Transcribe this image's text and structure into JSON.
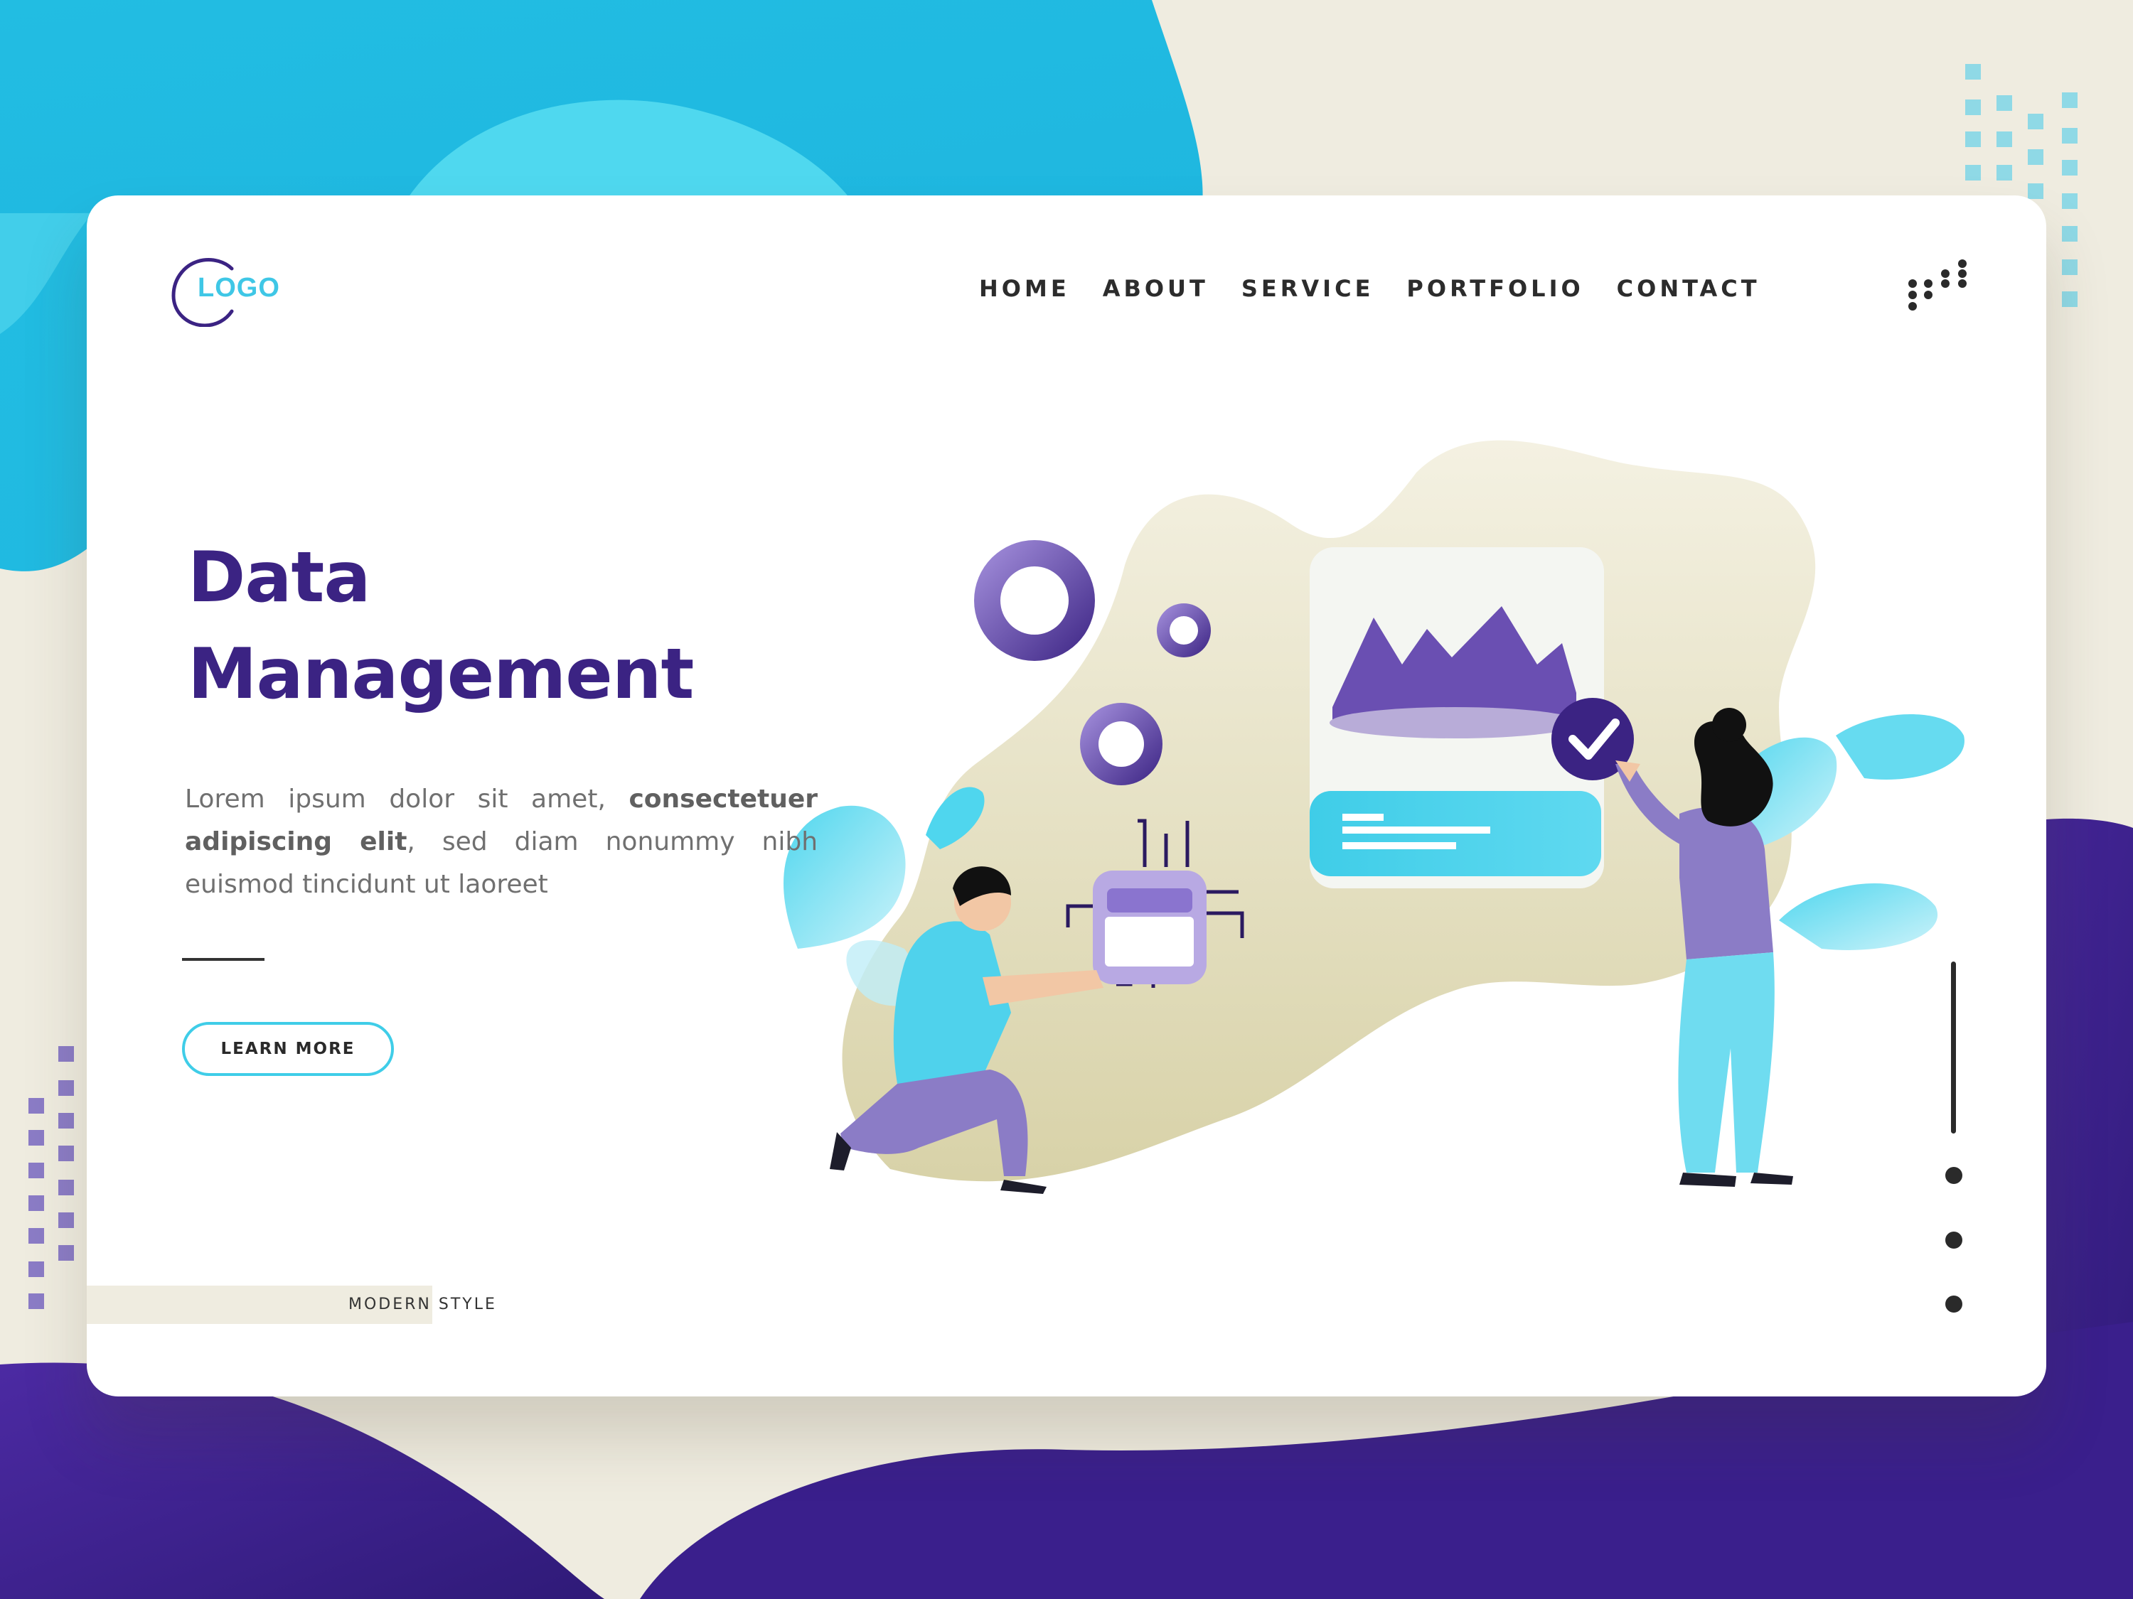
{
  "colors": {
    "brand_purple": "#3b2383",
    "accent_cyan": "#3fcde8",
    "cream": "#efece0",
    "lavender": "#8b7cc6"
  },
  "header": {
    "logo_text": "LOGO",
    "nav": [
      "HOME",
      "ABOUT",
      "SERVICE",
      "PORTFOLIO",
      "CONTACT"
    ],
    "menu_icon": "dots-grid-icon"
  },
  "hero": {
    "title_line1": "Data",
    "title_line2": "Management",
    "desc_part1": "Lorem ipsum dolor sit amet, ",
    "desc_bold": "consectetuer adipiscing elit",
    "desc_part2": ", sed diam nonummy nibh euismod tincidunt ut laoreet",
    "button_label": "LEARN MORE"
  },
  "footer": {
    "tagline": "MODERN STYLE"
  },
  "illustration_icons": [
    "gear-icon",
    "chip-icon",
    "mountain-chart-icon",
    "checkmark-icon",
    "man-figure",
    "woman-figure",
    "leaf-shape"
  ]
}
